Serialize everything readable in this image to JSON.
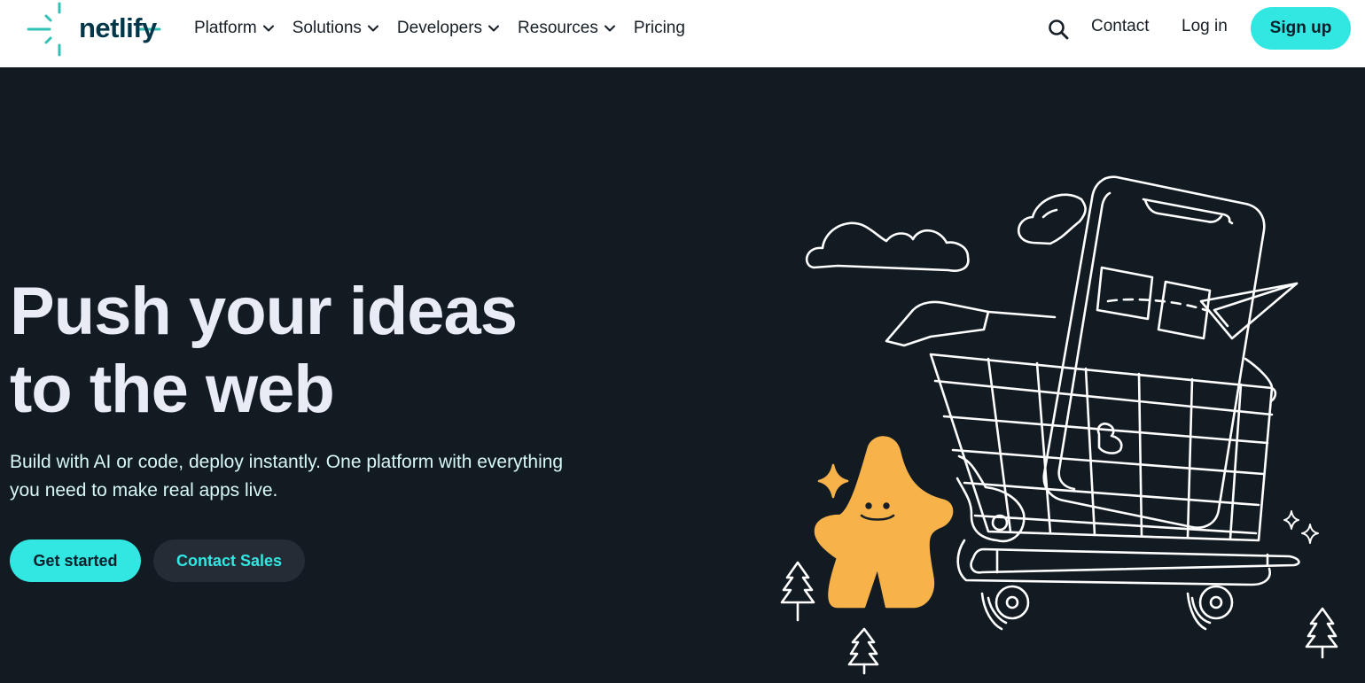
{
  "nav": {
    "logo_text": "netlify",
    "items": [
      {
        "label": "Platform",
        "has_dropdown": true
      },
      {
        "label": "Solutions",
        "has_dropdown": true
      },
      {
        "label": "Developers",
        "has_dropdown": true
      },
      {
        "label": "Resources",
        "has_dropdown": true
      },
      {
        "label": "Pricing",
        "has_dropdown": false
      }
    ],
    "search_icon": "search-icon",
    "contact_label": "Contact",
    "login_label": "Log in",
    "signup_label": "Sign up"
  },
  "hero": {
    "headline_line1": "Push your ideas",
    "headline_line2": "to the web",
    "subtext_line1": "Build with AI or code, deploy instantly. One platform with everything",
    "subtext_line2": "you need to make real apps live.",
    "primary_cta": "Get started",
    "secondary_cta": "Contact Sales"
  },
  "colors": {
    "accent": "#32e6e2",
    "hero_bg": "#121a22",
    "nav_bg": "#ffffff",
    "logo_text": "#04364a",
    "mascot": "#f7b24a"
  }
}
